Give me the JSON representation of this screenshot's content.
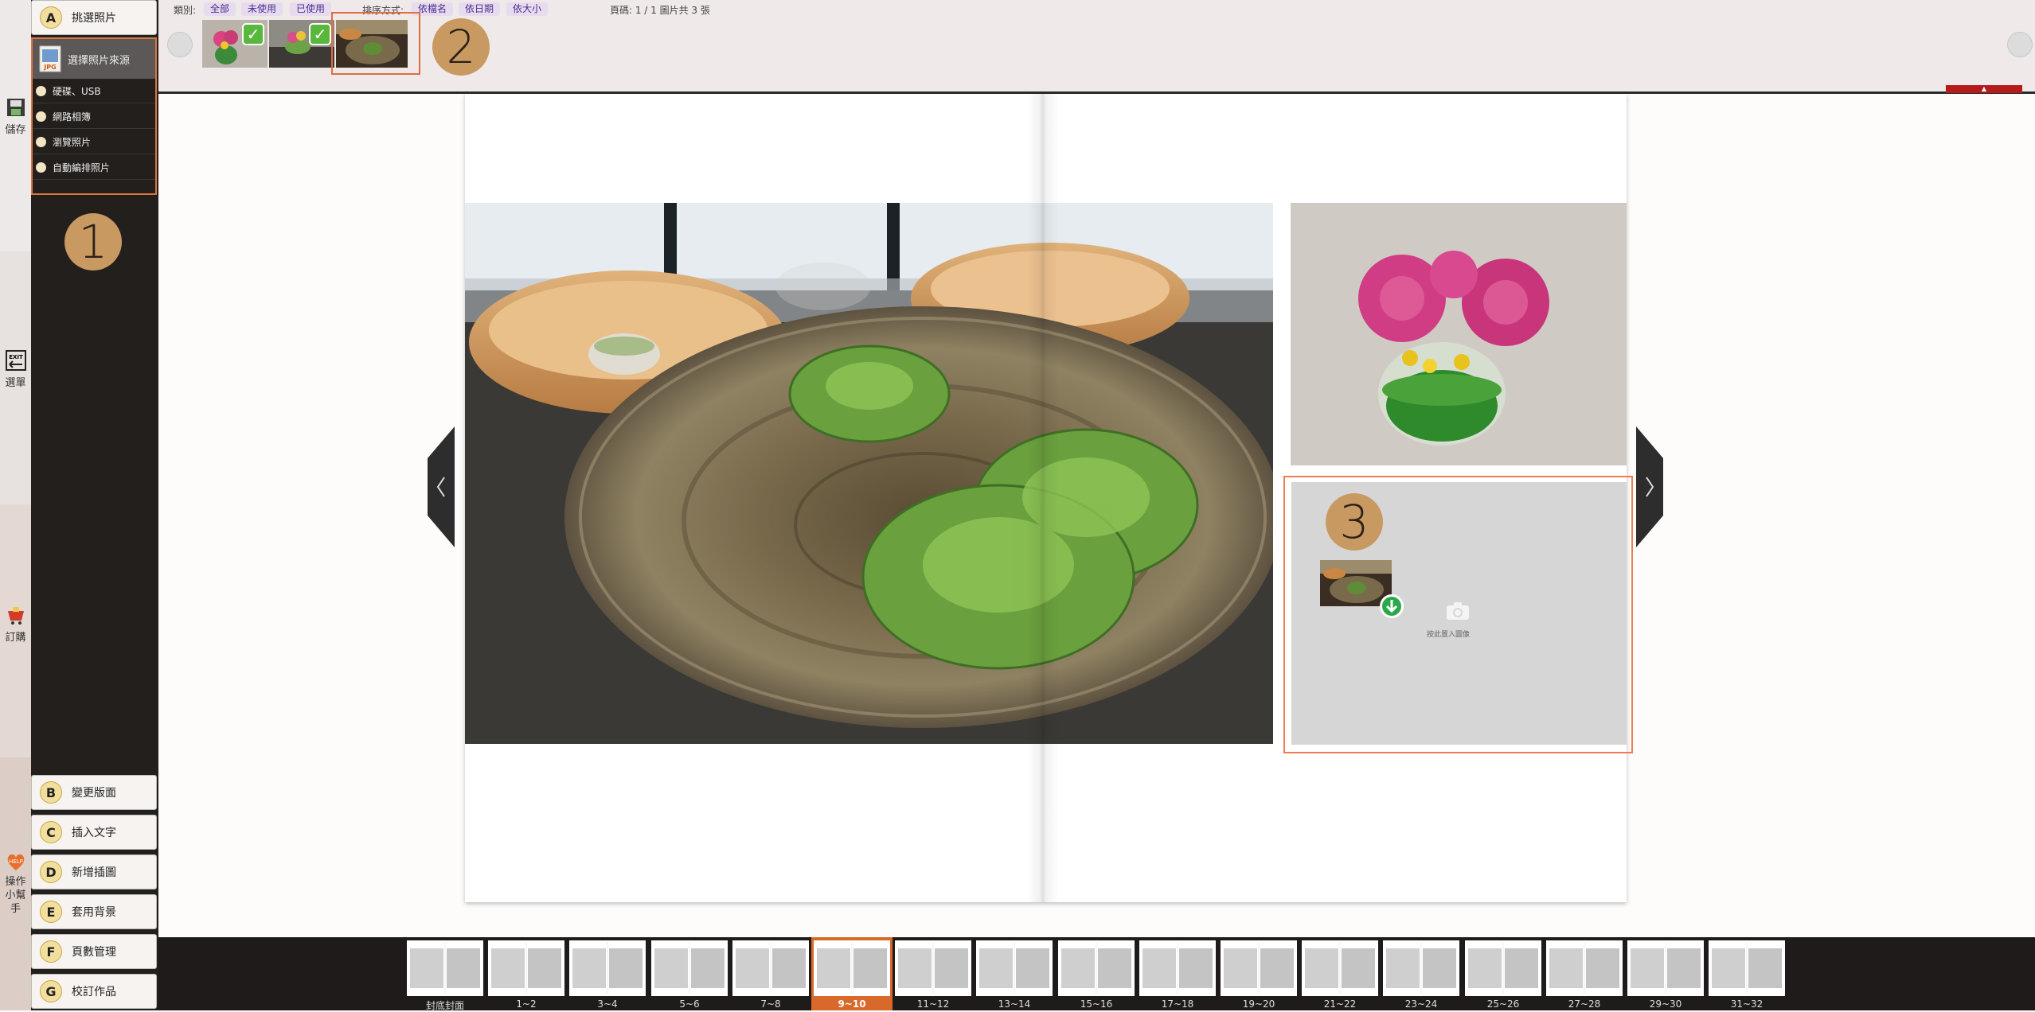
{
  "rail": {
    "save_label": "儲存",
    "menu_label": "選單",
    "order_label": "訂購",
    "help_label": "操作小幫手"
  },
  "left_panel": {
    "menu_a": {
      "letter": "A",
      "label": "挑選照片"
    },
    "source_header": "選擇照片來源",
    "sources": [
      "硬碟、USB",
      "網路相簿",
      "瀏覽照片",
      "自動編排照片"
    ],
    "buttons": [
      {
        "letter": "B",
        "label": "變更版面"
      },
      {
        "letter": "C",
        "label": "插入文字"
      },
      {
        "letter": "D",
        "label": "新增插圖"
      },
      {
        "letter": "E",
        "label": "套用背景"
      },
      {
        "letter": "F",
        "label": "頁數管理"
      },
      {
        "letter": "G",
        "label": "校訂作品"
      }
    ]
  },
  "callouts": {
    "one": "1",
    "two": "2",
    "three": "3"
  },
  "topbar": {
    "category_label": "類別:",
    "categories": [
      "全部",
      "未使用",
      "已使用"
    ],
    "sort_label": "排序方式:",
    "sorts": [
      "依檔名",
      "依日期",
      "依大小"
    ],
    "page_info": "頁碼: 1 / 1  圖片共 3 張",
    "thumbs": [
      {
        "subject": "flower-vase",
        "used": true
      },
      {
        "subject": "flower-vase-table",
        "used": true
      },
      {
        "subject": "plate-water-lettuce",
        "used": false,
        "selected": true
      }
    ]
  },
  "book": {
    "left_photo": "plate-water-lettuce",
    "right_photo": "pink-flowers-vase",
    "placeholder_text": "按此置入圖像"
  },
  "filmstrip": {
    "selected": "9~10",
    "pages": [
      "封底封面",
      "1~2",
      "3~4",
      "5~6",
      "7~8",
      "9~10",
      "11~12",
      "13~14",
      "15~16",
      "17~18",
      "19~20",
      "21~22",
      "23~24",
      "25~26",
      "27~28",
      "29~30",
      "31~32"
    ]
  },
  "colors": {
    "accent": "#d9773e",
    "panel": "#231f1d",
    "badge": "#c89a62",
    "check": "#58b83c"
  }
}
